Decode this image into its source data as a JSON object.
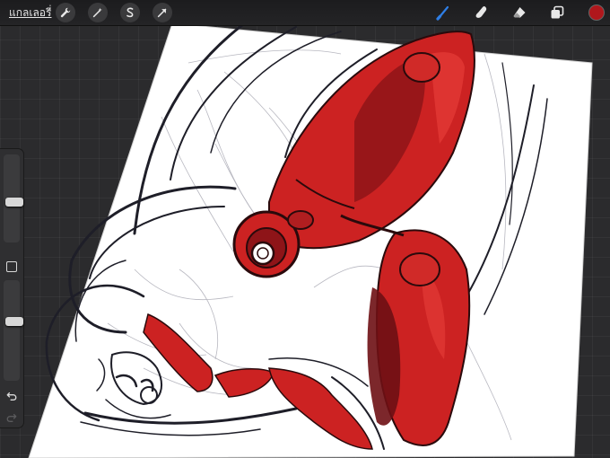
{
  "toolbar": {
    "gallery_label": "แกลเลอรี่",
    "left_tools": [
      {
        "name": "actions",
        "icon": "wrench-icon"
      },
      {
        "name": "adjustments",
        "icon": "magic-wand-icon"
      },
      {
        "name": "selection",
        "icon": "selection-s-icon"
      },
      {
        "name": "transform",
        "icon": "arrow-cursor-icon"
      }
    ],
    "right_tools": [
      {
        "name": "brush",
        "icon": "brush-icon",
        "active": true
      },
      {
        "name": "smudge",
        "icon": "smudge-finger-icon"
      },
      {
        "name": "eraser",
        "icon": "eraser-icon"
      },
      {
        "name": "layers",
        "icon": "layers-icon"
      }
    ],
    "current_color": "#b0171c",
    "active_tool_color": "#2f7fe6"
  },
  "sidebar": {
    "brush_size_level": 0.45,
    "opacity_level": 0.6,
    "modify_button_icon": "square-icon",
    "undo_icon": "undo-arrow-icon",
    "redo_icon": "redo-arrow-icon"
  },
  "colors": {
    "workspace_bg": "#2b2b2d",
    "paper": "#ffffff",
    "ink": "#1e1e28",
    "red_fill": "#cc2222",
    "red_dark": "#6e0f14"
  }
}
